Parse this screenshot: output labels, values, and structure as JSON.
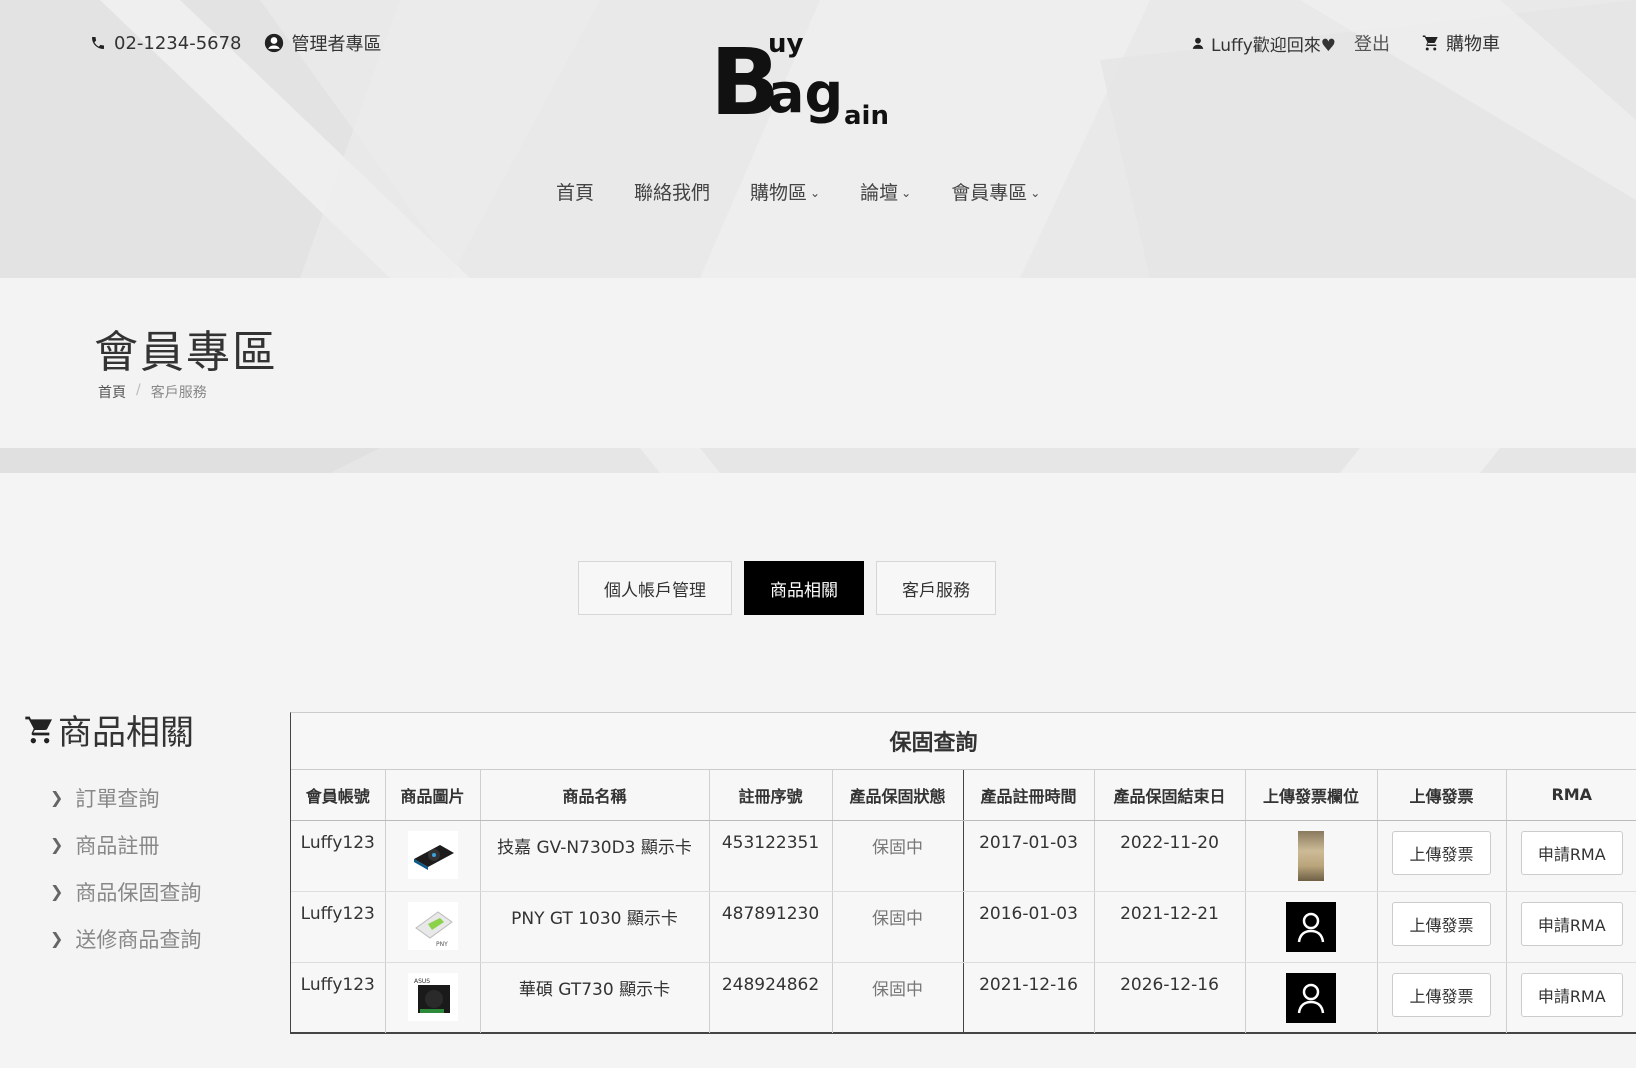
{
  "header": {
    "phone": "02-1234-5678",
    "admin_link": "管理者專區",
    "user_greeting": "Luffy歡迎回來♥",
    "logout": "登出",
    "cart": "購物車",
    "logo_text": {
      "big": "B",
      "uy": "uy",
      "ag": "ag",
      "ain": "ain"
    }
  },
  "nav": {
    "items": [
      {
        "label": "首頁",
        "has_dropdown": false
      },
      {
        "label": "聯絡我們",
        "has_dropdown": false
      },
      {
        "label": "購物區",
        "has_dropdown": true
      },
      {
        "label": "論壇",
        "has_dropdown": true
      },
      {
        "label": "會員專區",
        "has_dropdown": true
      }
    ]
  },
  "page": {
    "title": "會員專區",
    "breadcrumb": {
      "home": "首頁",
      "separator": "/",
      "current": "客戶服務"
    }
  },
  "tabs": [
    {
      "label": "個人帳戶管理",
      "active": false
    },
    {
      "label": "商品相關",
      "active": true
    },
    {
      "label": "客戶服務",
      "active": false
    }
  ],
  "sidebar": {
    "title": "商品相關",
    "items": [
      {
        "label": "訂單查詢"
      },
      {
        "label": "商品註冊"
      },
      {
        "label": "商品保固查詢"
      },
      {
        "label": "送修商品查詢"
      }
    ]
  },
  "warranty": {
    "title": "保固查詢",
    "columns": [
      "會員帳號",
      "商品圖片",
      "商品名稱",
      "註冊序號",
      "產品保固狀態",
      "產品註冊時間",
      "產品保固結束日",
      "上傳發票欄位",
      "上傳發票",
      "RMA"
    ],
    "rows": [
      {
        "account": "Luffy123",
        "name": "技嘉 GV-N730D3 顯示卡",
        "serial": "453122351",
        "status": "保固中",
        "reg_date": "2017-01-03",
        "end_date": "2022-11-20",
        "upload_label": "上傳發票",
        "rma_label": "申請RMA"
      },
      {
        "account": "Luffy123",
        "name": "PNY GT 1030 顯示卡",
        "serial": "487891230",
        "status": "保固中",
        "reg_date": "2016-01-03",
        "end_date": "2021-12-21",
        "upload_label": "上傳發票",
        "rma_label": "申請RMA"
      },
      {
        "account": "Luffy123",
        "name": "華碩 GT730 顯示卡",
        "serial": "248924862",
        "status": "保固中",
        "reg_date": "2021-12-16",
        "end_date": "2026-12-16",
        "upload_label": "上傳發票",
        "rma_label": "申請RMA"
      }
    ]
  },
  "colors": {
    "accent": "#000000",
    "header_bg": "#e9e9e9",
    "page_bg": "#f4f4f4"
  }
}
